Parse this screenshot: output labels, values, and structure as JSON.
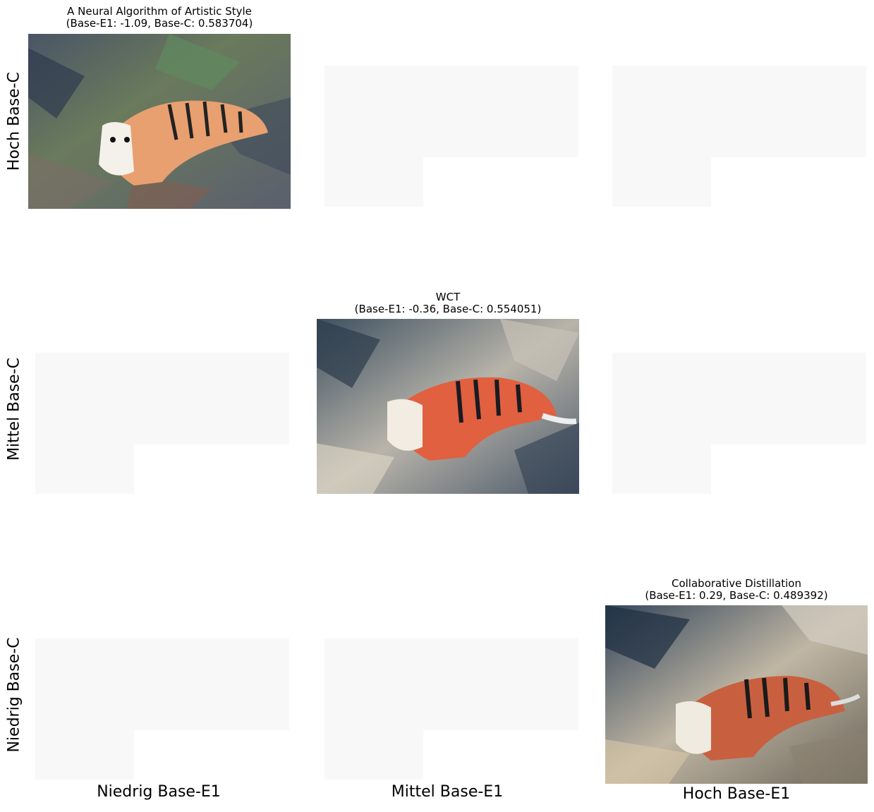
{
  "rows": [
    {
      "label": "Hoch Base-C"
    },
    {
      "label": "Mittel Base-C"
    },
    {
      "label": "Niedrig Base-C"
    }
  ],
  "columns": [
    {
      "label": "Niedrig Base-E1"
    },
    {
      "label": "Mittel Base-E1"
    },
    {
      "label": "Hoch Base-E1"
    }
  ],
  "cells": [
    {
      "title": "A Neural Algorithm of Artistic Style",
      "subtitle": "(Base-E1: -1.09, Base-C: 0.583704)"
    },
    {
      "title": "WCT",
      "subtitle": "(Base-E1: -0.36, Base-C: 0.554051)"
    },
    {
      "title": "Collaborative Distillation",
      "subtitle": "(Base-E1: 0.29, Base-C: 0.489392)"
    }
  ],
  "colors": {
    "background": "#ffffff",
    "ghost": "#f3f3f3"
  }
}
